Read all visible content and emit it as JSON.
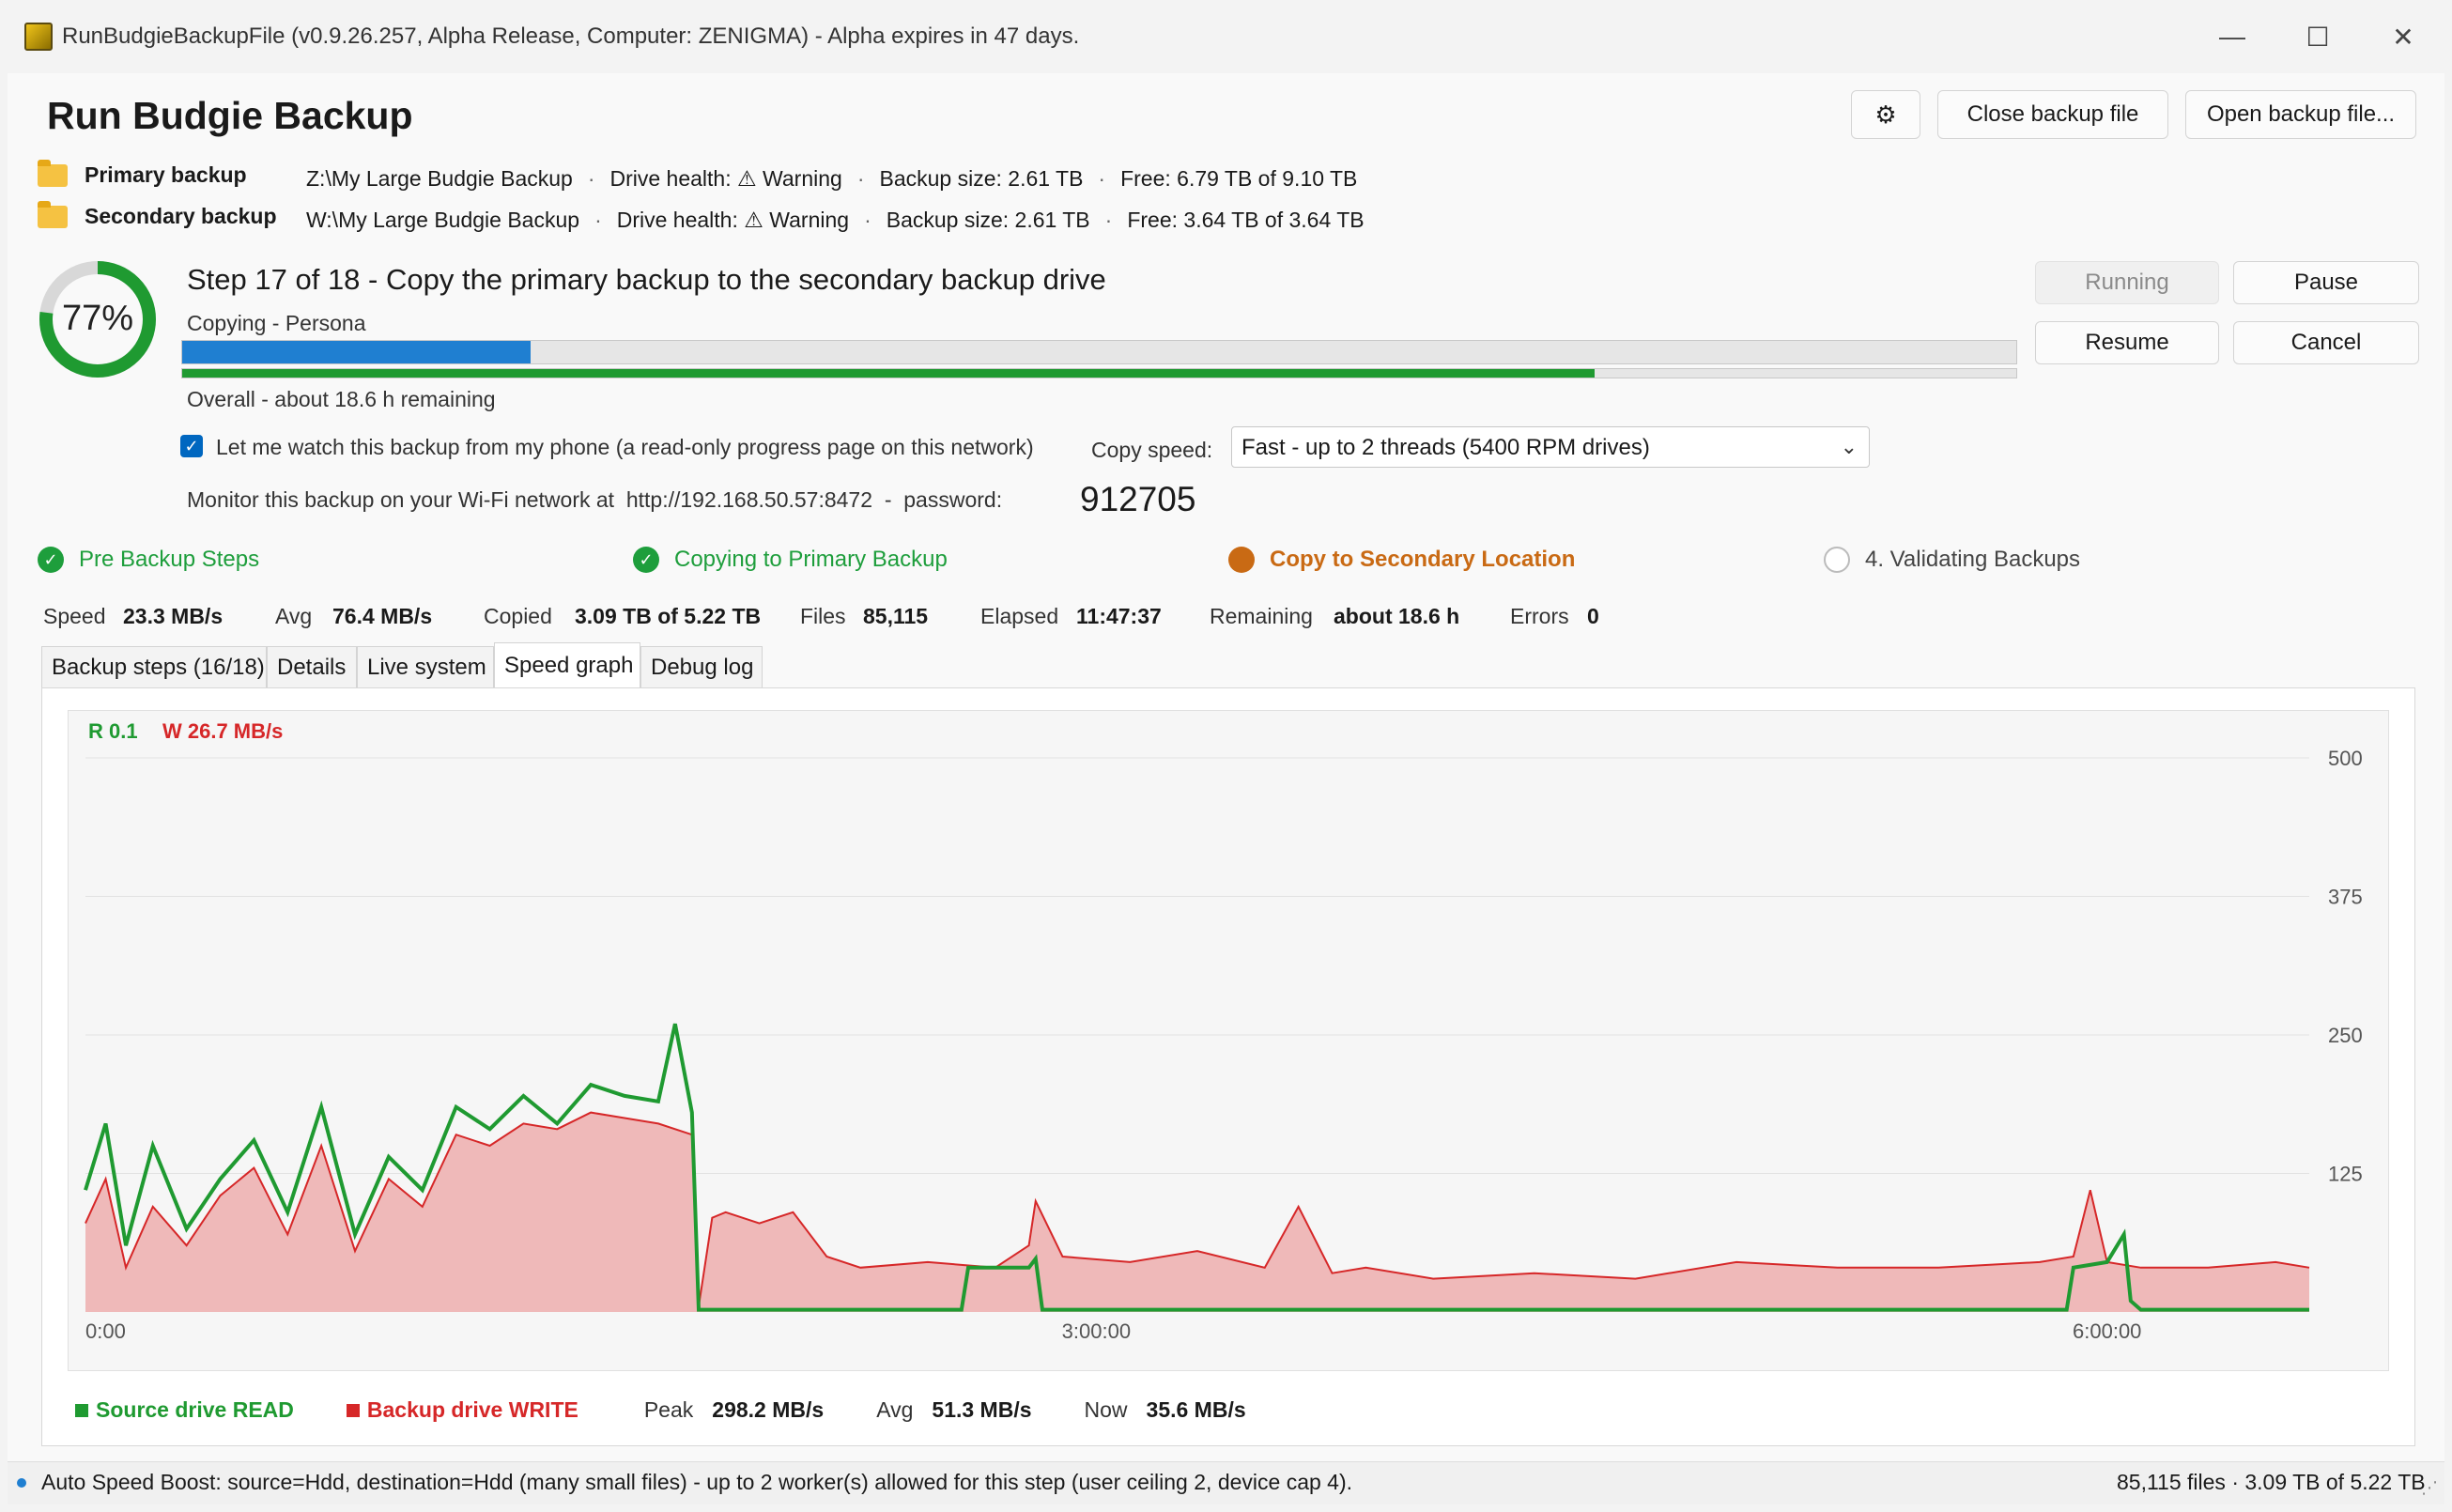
{
  "window": {
    "title": "RunBudgieBackupFile (v0.9.26.257, Alpha Release, Computer: ZENIGMA) - Alpha expires in 47 days.",
    "minimize": "—",
    "maximize": "☐",
    "close": "✕"
  },
  "header": {
    "title": "Run Budgie Backup",
    "settings_icon": "⚙",
    "close_button": "Close backup file",
    "open_button": "Open backup file..."
  },
  "primary": {
    "label": "Primary backup",
    "path": "Z:\\My Large Budgie Backup",
    "health_label": "Drive health:",
    "health_value": "⚠ Warning",
    "size": "Backup size: 2.61 TB",
    "free": "Free: 6.79 TB of 9.10 TB"
  },
  "secondary": {
    "label": "Secondary backup",
    "path": "W:\\My Large Budgie Backup",
    "health_label": "Drive health:",
    "health_value": "⚠ Warning",
    "size": "Backup size: 2.61 TB",
    "free": "Free: 3.64 TB of 3.64 TB"
  },
  "progress": {
    "percent_text": "77%",
    "overall_fraction": 0.77,
    "step_title": "Step 17 of 18 - Copy the primary backup to the secondary backup drive",
    "current_item": "Copying - Persona",
    "step_fraction": 0.19,
    "overall_label": "Overall - about 18.6 h remaining"
  },
  "controls": {
    "running": "Running",
    "pause": "Pause",
    "resume": "Resume",
    "cancel": "Cancel"
  },
  "phone": {
    "checkbox_checked": true,
    "checkbox_label": "Let me watch this backup from my phone (a read-only progress page on this network)",
    "monitor_text": "Monitor this backup on your Wi-Fi network at",
    "url": "http://192.168.50.57:8472",
    "dash": "-",
    "password_label": "password:",
    "password": "912705"
  },
  "copy_speed": {
    "label": "Copy speed:",
    "value": "Fast - up to 2 threads (5400 RPM drives)"
  },
  "phases": [
    {
      "label": "Pre Backup Steps",
      "state": "done",
      "color": "#1e9e3c"
    },
    {
      "label": "Copying to Primary Backup",
      "state": "done",
      "color": "#1e9e3c"
    },
    {
      "label": "Copy to Secondary Location",
      "state": "active",
      "color": "#c96a14"
    },
    {
      "label": "4. Validating Backups",
      "state": "pending",
      "color": "#555555"
    }
  ],
  "stats": {
    "speed_label": "Speed",
    "speed": "23.3 MB/s",
    "avg_label": "Avg",
    "avg": "76.4 MB/s",
    "copied_label": "Copied",
    "copied": "3.09 TB of 5.22 TB",
    "files_label": "Files",
    "files": "85,115",
    "elapsed_label": "Elapsed",
    "elapsed": "11:47:37",
    "remaining_label": "Remaining",
    "remaining": "about 18.6 h",
    "errors_label": "Errors",
    "errors": "0"
  },
  "tabs": [
    {
      "label": "Backup steps (16/18)",
      "active": false
    },
    {
      "label": "Details",
      "active": false
    },
    {
      "label": "Live system",
      "active": false
    },
    {
      "label": "Speed graph",
      "active": true
    },
    {
      "label": "Debug log",
      "active": false
    }
  ],
  "graph": {
    "read_now": "R 0.1",
    "write_now": "W 26.7 MB/s",
    "legend_read": "Source drive READ",
    "legend_write": "Backup drive WRITE",
    "peak_label": "Peak",
    "peak": "298.2 MB/s",
    "avg_label": "Avg",
    "avg": "51.3 MB/s",
    "now_label": "Now",
    "now": "35.6 MB/s"
  },
  "chart_data": {
    "type": "area",
    "title": "",
    "xlabel": "",
    "ylabel": "",
    "x_unit": "elapsed time (h)",
    "xlim": [
      0,
      6.6
    ],
    "ylim": [
      0,
      500
    ],
    "yticks": [
      125,
      250,
      375,
      500
    ],
    "xtick_labels": [
      {
        "x": 0,
        "label": "0:00"
      },
      {
        "x": 3,
        "label": "3:00:00"
      },
      {
        "x": 6,
        "label": "6:00:00"
      }
    ],
    "grid": true,
    "colors": {
      "read": "#1f9a31",
      "write": "#d62728",
      "write_fill": "#efb9b9"
    },
    "series": [
      {
        "name": "Source drive READ",
        "x": [
          0,
          0.06,
          0.12,
          0.2,
          0.3,
          0.4,
          0.5,
          0.6,
          0.7,
          0.8,
          0.9,
          1.0,
          1.1,
          1.2,
          1.3,
          1.4,
          1.5,
          1.6,
          1.7,
          1.75,
          1.8,
          1.82,
          1.84,
          1.9,
          2.0,
          2.4,
          2.6,
          2.62,
          2.8,
          2.82,
          2.84,
          3.0,
          3.5,
          4.0,
          4.5,
          5.0,
          5.5,
          5.88,
          5.9,
          6.0,
          6.05,
          6.07,
          6.1,
          6.2,
          6.3,
          6.6
        ],
        "y": [
          110,
          170,
          60,
          150,
          75,
          120,
          155,
          90,
          185,
          70,
          140,
          110,
          185,
          165,
          195,
          170,
          205,
          195,
          190,
          260,
          180,
          2,
          2,
          2,
          2,
          2,
          2,
          40,
          40,
          48,
          2,
          2,
          2,
          2,
          2,
          2,
          2,
          2,
          40,
          45,
          70,
          10,
          2,
          2,
          2,
          2
        ]
      },
      {
        "name": "Backup drive WRITE",
        "x": [
          0,
          0.06,
          0.12,
          0.2,
          0.3,
          0.4,
          0.5,
          0.6,
          0.7,
          0.8,
          0.9,
          1.0,
          1.1,
          1.2,
          1.3,
          1.4,
          1.5,
          1.6,
          1.7,
          1.8,
          1.82,
          1.86,
          1.9,
          2.0,
          2.1,
          2.2,
          2.3,
          2.5,
          2.7,
          2.8,
          2.82,
          2.9,
          3.1,
          3.3,
          3.5,
          3.6,
          3.7,
          3.8,
          4.0,
          4.3,
          4.6,
          4.9,
          5.2,
          5.5,
          5.8,
          5.9,
          5.95,
          6.0,
          6.1,
          6.3,
          6.5,
          6.6
        ],
        "y": [
          80,
          120,
          40,
          95,
          60,
          105,
          130,
          70,
          150,
          55,
          120,
          95,
          160,
          150,
          170,
          165,
          180,
          175,
          170,
          160,
          5,
          85,
          90,
          80,
          90,
          50,
          40,
          45,
          40,
          60,
          100,
          50,
          45,
          55,
          40,
          95,
          35,
          40,
          30,
          35,
          30,
          45,
          40,
          40,
          45,
          50,
          110,
          45,
          40,
          40,
          45,
          40
        ]
      }
    ]
  },
  "status": {
    "message": "Auto Speed Boost: source=Hdd, destination=Hdd (many small files) - up to 2 worker(s) allowed for this step (user ceiling 2, device cap 4).",
    "summary": "85,115 files · 3.09 TB of 5.22 TB"
  }
}
